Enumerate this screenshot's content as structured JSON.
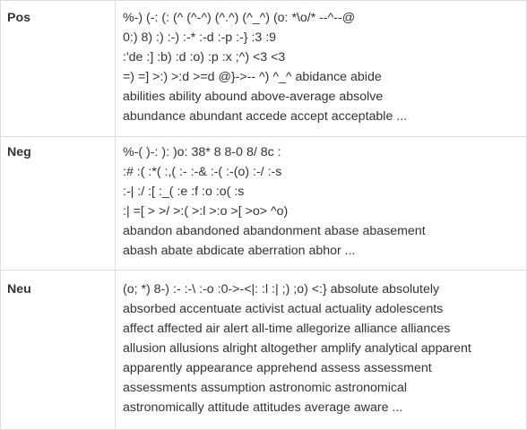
{
  "rows": [
    {
      "label": "Pos",
      "lines": [
        "%-) (-: (: (^ (^-^) (^.^) (^_^) (o: *\\o/* --^--@",
        "0:) 8) :) :-) :-* :-d :-p :-} :3 :9",
        ":'de :] :b) :d :o) :p :x ;^) <3 <3",
        "=) =] >:) >:d >=d @}->-- ^) ^_^ abidance abide",
        "abilities ability abound above-average absolve",
        "abundance abundant accede accept acceptable ..."
      ]
    },
    {
      "label": "Neg",
      "lines": [
        "%-( )-: ): )o: 38* 8 8-0 8/ 8c :",
        ":# :( :*( :,( :- :-& :-( :-(o) :-/ :-s",
        ":-| :/ :[ :_( :e :f :o :o( :s",
        ":| =[ > >/ >:( >:l >:o >[ >o> ^o)",
        "abandon abandoned abandonment abase abasement",
        "abash abate abdicate aberration abhor ..."
      ]
    },
    {
      "label": "Neu",
      "lines": [
        "(o; *) 8-) :- :-\\ :-o :0->-<|: :l :| ;) ;o) <:} absolute absolutely",
        "absorbed accentuate activist actual actuality adolescents",
        "affect affected air alert all-time allegorize alliance alliances",
        "allusion allusions alright altogether amplify analytical apparent",
        "apparently appearance apprehend assess assessment",
        "assessments assumption astronomic astronomical",
        "astronomically attitude attitudes average aware ..."
      ]
    }
  ]
}
